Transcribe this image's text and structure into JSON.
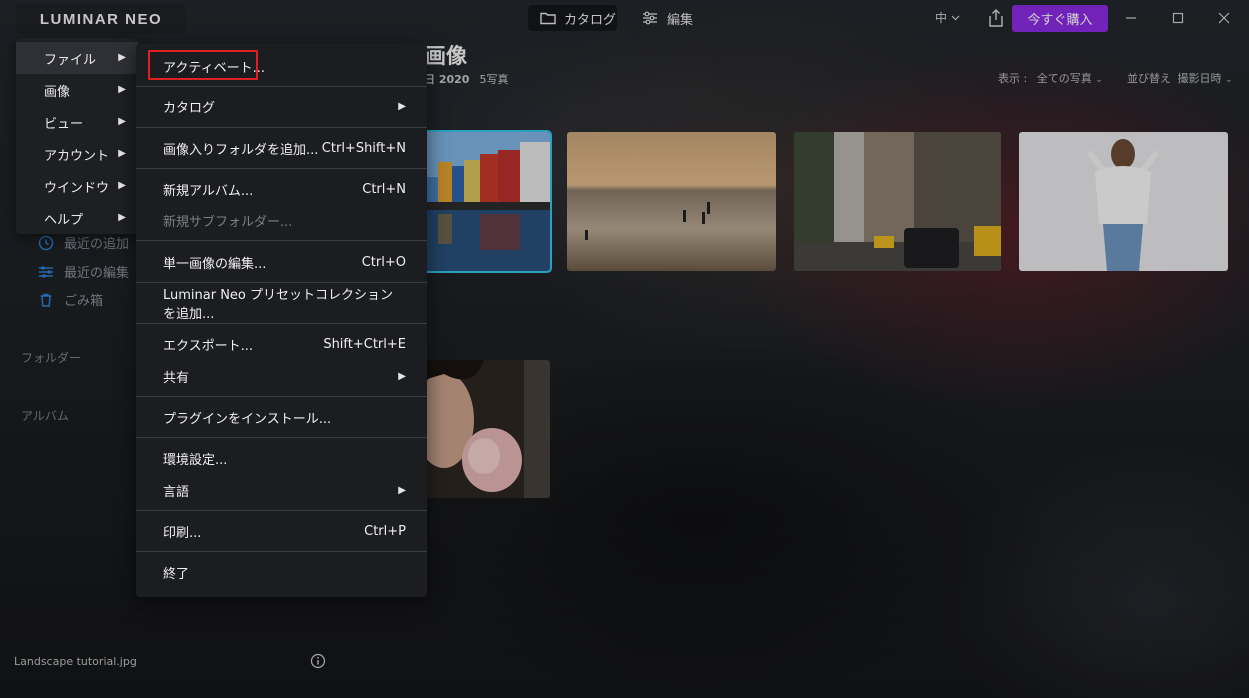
{
  "app": {
    "logo_text": "LUMINAR NEO",
    "tabs": {
      "catalog": "カタログ",
      "edit": "編集"
    },
    "zoom": "中",
    "buy_button": "今すぐ購入",
    "accent_color": "#8a2be2",
    "selection_color": "#35c2e6"
  },
  "sidebar": {
    "items": [
      {
        "label": "最近の追加",
        "icon": "clock-icon"
      },
      {
        "label": "最近の編集",
        "icon": "sliders-icon"
      },
      {
        "label": "ごみ箱",
        "icon": "trash-icon"
      }
    ],
    "folders_label": "フォルダー",
    "albums_label": "アルバム"
  },
  "content": {
    "title": "画像",
    "date_fragment": "日 2020",
    "photo_count": "5写真",
    "view_label": "表示 :",
    "view_value": "全ての写真",
    "sort_label": "並び替え",
    "sort_value": "撮影日時"
  },
  "status": {
    "filename": "Landscape tutorial.jpg"
  },
  "main_menu": {
    "items": [
      {
        "label": "ファイル",
        "active": true
      },
      {
        "label": "画像"
      },
      {
        "label": "ビュー"
      },
      {
        "label": "アカウント"
      },
      {
        "label": "ウインドウ"
      },
      {
        "label": "ヘルプ"
      }
    ]
  },
  "file_menu": {
    "items": [
      {
        "label": "アクティベート...",
        "shortcut": "",
        "submenu": false,
        "disabled": false
      },
      {
        "label": "カタログ",
        "shortcut": "",
        "submenu": true,
        "disabled": false
      },
      {
        "label": "画像入りフォルダを追加...",
        "shortcut": "Ctrl+Shift+N",
        "submenu": false,
        "disabled": false
      },
      {
        "label": "新規アルバム...",
        "shortcut": "Ctrl+N",
        "submenu": false,
        "disabled": false
      },
      {
        "label": "新規サブフォルダー...",
        "shortcut": "",
        "submenu": false,
        "disabled": true
      },
      {
        "label": "単一画像の編集...",
        "shortcut": "Ctrl+O",
        "submenu": false,
        "disabled": false
      },
      {
        "label": "Luminar Neo プリセットコレクションを追加...",
        "shortcut": "",
        "submenu": false,
        "disabled": false
      },
      {
        "label": "エクスポート...",
        "shortcut": "Shift+Ctrl+E",
        "submenu": false,
        "disabled": false
      },
      {
        "label": "共有",
        "shortcut": "",
        "submenu": true,
        "disabled": false
      },
      {
        "label": "プラグインをインストール...",
        "shortcut": "",
        "submenu": false,
        "disabled": false
      },
      {
        "label": "環境設定...",
        "shortcut": "",
        "submenu": false,
        "disabled": false
      },
      {
        "label": "言語",
        "shortcut": "",
        "submenu": true,
        "disabled": false
      },
      {
        "label": "印刷...",
        "shortcut": "Ctrl+P",
        "submenu": false,
        "disabled": false
      },
      {
        "label": "終了",
        "shortcut": "",
        "submenu": false,
        "disabled": false
      }
    ]
  }
}
